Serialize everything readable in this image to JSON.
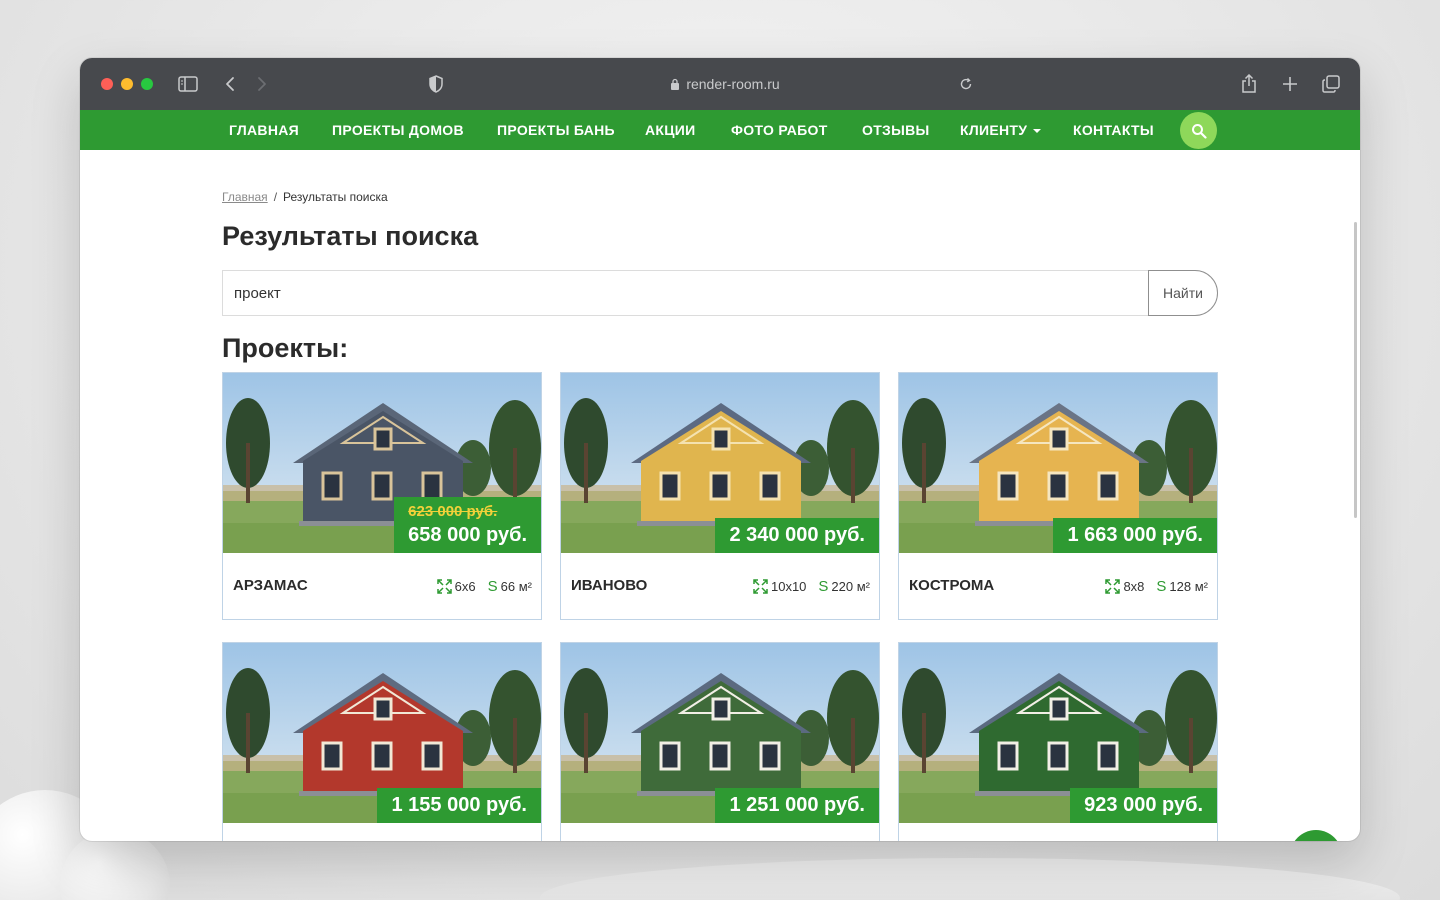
{
  "browser": {
    "url": "render-room.ru"
  },
  "nav": {
    "items": [
      {
        "label": "ГЛАВНАЯ"
      },
      {
        "label": "ПРОЕКТЫ ДОМОВ"
      },
      {
        "label": "ПРОЕКТЫ БАНЬ"
      },
      {
        "label": "АКЦИИ"
      },
      {
        "label": "ФОТО РАБОТ"
      },
      {
        "label": "ОТЗЫВЫ"
      },
      {
        "label": "КЛИЕНТУ"
      },
      {
        "label": "КОНТАКТЫ"
      }
    ]
  },
  "breadcrumb": {
    "home": "Главная",
    "separator": "/",
    "current": "Результаты поиска"
  },
  "page": {
    "title": "Результаты поиска",
    "section_title": "Проекты:"
  },
  "search": {
    "value": "проект",
    "button": "Найти"
  },
  "spec_s_symbol": "S",
  "projects": [
    {
      "name": "АРЗАМАС",
      "price": "658 000 руб.",
      "old_price": "623 000 руб.",
      "size": "6x6",
      "area": "66 м²",
      "wall_color": "#4a5566",
      "roof_color": "#5a6678",
      "trim_color": "#d9c49a"
    },
    {
      "name": "ИВАНОВО",
      "price": "2 340 000 руб.",
      "old_price": "",
      "size": "10x10",
      "area": "220 м²",
      "wall_color": "#e0b54e",
      "roof_color": "#5c6a82",
      "trim_color": "#f4e2b0"
    },
    {
      "name": "КОСТРОМА",
      "price": "1 663 000 руб.",
      "old_price": "",
      "size": "8x8",
      "area": "128 м²",
      "wall_color": "#e6b450",
      "roof_color": "#6a7486",
      "trim_color": "#f5e6c0"
    },
    {
      "name": "",
      "price": "1 155 000 руб.",
      "old_price": "",
      "size": "",
      "area": "",
      "wall_color": "#b3382c",
      "roof_color": "#5e6b80",
      "trim_color": "#f1e8d6"
    },
    {
      "name": "",
      "price": "1 251 000 руб.",
      "old_price": "",
      "size": "",
      "area": "",
      "wall_color": "#3f6b3a",
      "roof_color": "#5b6a80",
      "trim_color": "#f2efe6"
    },
    {
      "name": "",
      "price": "923 000 руб.",
      "old_price": "",
      "size": "",
      "area": "",
      "wall_color": "#2f6a30",
      "roof_color": "#5b6a80",
      "trim_color": "#f2efe6"
    }
  ],
  "colors": {
    "nav_green": "#2e9a32",
    "search_circle": "#8ed85a",
    "old_price_yellow": "#f2d13a"
  }
}
